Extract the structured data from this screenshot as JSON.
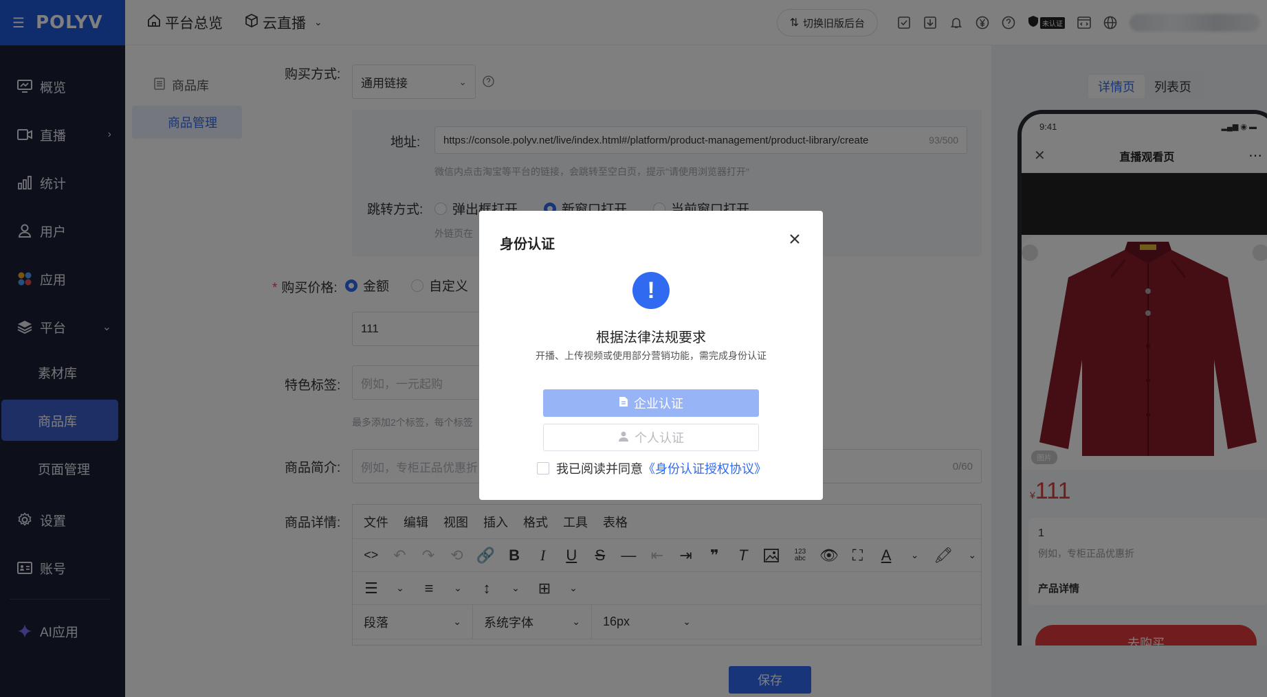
{
  "brand": {
    "logo": "POLYV"
  },
  "sidebar": {
    "items": [
      {
        "label": "概览"
      },
      {
        "label": "直播"
      },
      {
        "label": "统计"
      },
      {
        "label": "用户"
      },
      {
        "label": "应用"
      },
      {
        "label": "平台"
      },
      {
        "label": "设置"
      },
      {
        "label": "账号"
      },
      {
        "label": "AI应用"
      }
    ],
    "platform_sub": [
      {
        "label": "素材库"
      },
      {
        "label": "商品库"
      },
      {
        "label": "页面管理"
      }
    ]
  },
  "topbar": {
    "home": "平台总览",
    "cloud_live": "云直播",
    "switch_label": "切换旧版后台",
    "unverified_badge": "未认证"
  },
  "subnav": {
    "items": [
      {
        "label": "商品库"
      },
      {
        "label": "商品管理"
      }
    ]
  },
  "form": {
    "buy_method_label": "购买方式:",
    "buy_method_value": "通用链接",
    "address_label": "地址:",
    "address_value": "https://console.polyv.net/live/index.html#/platform/product-management/product-library/create",
    "address_count": "93/500",
    "address_hint": "微信内点击淘宝等平台的链接，会跳转至空白页，提示\"请使用浏览器打开\"",
    "jump_label": "跳转方式:",
    "jump_options": [
      "弹出框打开",
      "新窗口打开",
      "当前窗口打开"
    ],
    "external_hint": "外链页在",
    "price_label": "购买价格:",
    "price_options": [
      "金额",
      "自定义"
    ],
    "price_value": "111",
    "tag_label": "特色标签:",
    "tag_placeholder": "例如，一元起购",
    "tag_hint": "最多添加2个标签，每个标签",
    "intro_label": "商品简介:",
    "intro_placeholder": "例如，专柜正品优惠折",
    "intro_count": "0/60",
    "detail_label": "商品详情:",
    "save": "保存"
  },
  "editor": {
    "menus": [
      "文件",
      "编辑",
      "视图",
      "插入",
      "格式",
      "工具",
      "表格"
    ],
    "block_format": "段落",
    "font_family": "系统字体",
    "font_size": "16px"
  },
  "preview": {
    "tabs": [
      "详情页",
      "列表页"
    ],
    "time": "9:41",
    "page_title": "直播观看页",
    "tag": "图片",
    "currency": "¥",
    "price": "111",
    "card_value": "1",
    "card_placeholder": "例如，专柜正品优惠折",
    "card_section": "产品详情",
    "buy_button": "去购买"
  },
  "modal": {
    "title": "身份认证",
    "heading": "根据法律法规要求",
    "subtext": "开播、上传视频或使用部分营销功能，需完成身份认证",
    "enterprise_button": "企业认证",
    "personal_button": "个人认证",
    "agree_text": "我已阅读并同意",
    "agree_link": "《身份认证授权协议》"
  },
  "colors": {
    "primary": "#2f6af0",
    "sidebar_bg": "#1a2135",
    "logo_bg": "#1e59d8",
    "danger": "#e23b3b"
  }
}
